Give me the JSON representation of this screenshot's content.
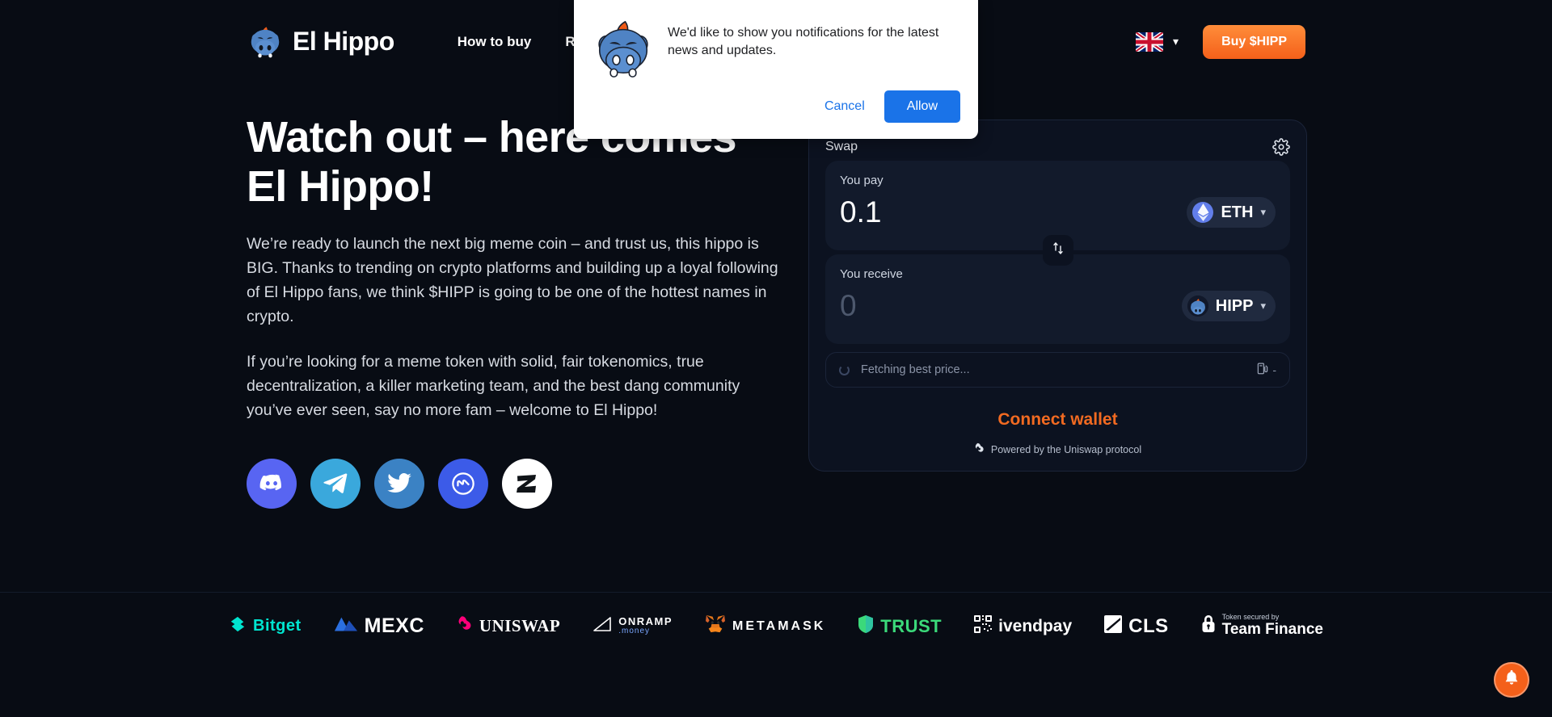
{
  "header": {
    "logo_text": "El Hippo",
    "logo_icon": "hippo-logo-icon",
    "nav": [
      {
        "label": "How to buy"
      },
      {
        "label": "Roadmap"
      }
    ],
    "language": {
      "flag": "uk-flag-icon",
      "chevron": "chevron-down-icon"
    },
    "buy_button": "Buy $HIPP"
  },
  "hero": {
    "title_line1": "Watch out – here comes",
    "title_line2": "El Hippo!",
    "paragraph1": "We’re ready to launch the next big meme coin – and trust us, this hippo is BIG. Thanks to trending on crypto platforms and building up a loyal following of El Hippo fans, we think $HIPP is going to be one of the hottest names in crypto.",
    "paragraph2": "If you’re looking for a meme token with solid, fair tokenomics, true decentralization, a killer marketing team, and the best dang community you’ve ever seen, say no more fam – welcome to El Hippo!",
    "socials": [
      {
        "name": "discord-icon",
        "color": "#5865f2"
      },
      {
        "name": "telegram-icon",
        "color": "#3aa8dc"
      },
      {
        "name": "twitter-icon",
        "color": "#3b82c4"
      },
      {
        "name": "coinmarketcap-icon",
        "color": "#3c5be8"
      },
      {
        "name": "zealy-icon",
        "color": "#ffffff"
      }
    ]
  },
  "swap": {
    "title": "Swap",
    "settings_icon": "gear-icon",
    "pay": {
      "label": "You pay",
      "amount": "0.1",
      "token": "ETH",
      "token_icon": "ethereum-icon"
    },
    "switch_icon": "swap-vertical-arrows-icon",
    "receive": {
      "label": "You receive",
      "amount": "0",
      "token": "HIPP",
      "token_icon": "hipp-token-icon"
    },
    "price_status": "Fetching best price...",
    "gas_icon": "gas-pump-icon",
    "gas_value": "-",
    "connect_label": "Connect wallet",
    "powered_by": "Powered by the Uniswap protocol",
    "powered_icon": "uniswap-unicorn-icon",
    "accent_color": "#f26a21"
  },
  "partners": [
    {
      "name": "Bitget",
      "icon": "bitget-logo-icon",
      "color": "#00e5d0"
    },
    {
      "name": "MEXC",
      "icon": "mexc-logo-icon",
      "color": "#2b6fe0"
    },
    {
      "name": "UNISWAP",
      "icon": "uniswap-logo-icon",
      "color": "#ff007a"
    },
    {
      "name": "ONRAMP",
      "sub": ".money",
      "icon": "onramp-logo-icon",
      "color": "#ffffff"
    },
    {
      "name": "METAMASK",
      "icon": "metamask-fox-icon",
      "color": "#e2761b"
    },
    {
      "name": "TRUST",
      "icon": "trust-wallet-icon",
      "color": "#3bd97a"
    },
    {
      "name": "ivendpay",
      "icon": "ivendpay-qr-icon",
      "color": "#ffffff"
    },
    {
      "name": "CLS",
      "icon": "cls-logo-icon",
      "color": "#ffffff"
    },
    {
      "name": "Team Finance",
      "sub": "Token secured by",
      "icon": "lock-icon",
      "color": "#ffffff"
    }
  ],
  "permission_dialog": {
    "icon": "hippo-avatar-icon",
    "message": "We'd like to show you notifications for the latest news and updates.",
    "cancel_label": "Cancel",
    "allow_label": "Allow",
    "allow_color": "#1a73e8"
  },
  "floating": {
    "bell_icon": "bell-icon",
    "bell_color": "#f4601a"
  }
}
